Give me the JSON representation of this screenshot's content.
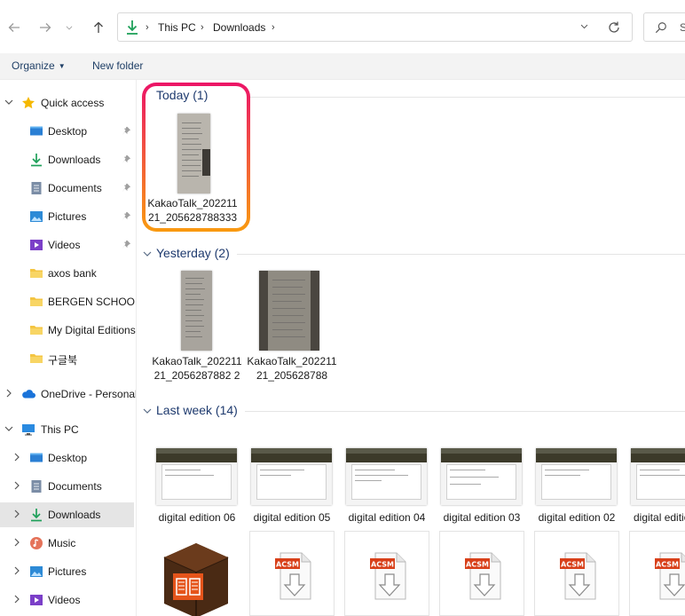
{
  "nav": {
    "back_icon": "arrow-left-icon",
    "forward_icon": "arrow-right-icon",
    "recent_icon": "chevron-down-icon",
    "up_icon": "arrow-up-icon"
  },
  "address": {
    "crumbs": [
      "This PC",
      "Downloads"
    ],
    "location_icon": "download-arrow-icon"
  },
  "search": {
    "placeholder": "S"
  },
  "command_bar": {
    "organize_label": "Organize",
    "new_folder_label": "New folder"
  },
  "sidebar": {
    "quick_access": {
      "label": "Quick access",
      "items": [
        {
          "label": "Desktop",
          "icon": "desktop-icon",
          "pinned": true
        },
        {
          "label": "Downloads",
          "icon": "download-arrow-icon",
          "pinned": true
        },
        {
          "label": "Documents",
          "icon": "documents-icon",
          "pinned": true
        },
        {
          "label": "Pictures",
          "icon": "pictures-icon",
          "pinned": true
        },
        {
          "label": "Videos",
          "icon": "videos-icon",
          "pinned": true
        },
        {
          "label": "axos bank",
          "icon": "folder-icon"
        },
        {
          "label": "BERGEN SCHOOL",
          "icon": "folder-icon"
        },
        {
          "label": "My Digital Editions",
          "icon": "folder-icon"
        },
        {
          "label": "구글북",
          "icon": "folder-icon"
        }
      ]
    },
    "onedrive": {
      "label": "OneDrive - Personal"
    },
    "this_pc": {
      "label": "This PC",
      "items": [
        {
          "label": "Desktop",
          "icon": "desktop-icon"
        },
        {
          "label": "Documents",
          "icon": "documents-icon"
        },
        {
          "label": "Downloads",
          "icon": "download-arrow-icon",
          "selected": true
        },
        {
          "label": "Music",
          "icon": "music-icon"
        },
        {
          "label": "Pictures",
          "icon": "pictures-icon"
        },
        {
          "label": "Videos",
          "icon": "videos-icon"
        }
      ]
    }
  },
  "groups": {
    "today": {
      "label": "Today (1)",
      "files": [
        {
          "name": "KakaoTalk_20221121_2056287883333"
        }
      ]
    },
    "yesterday": {
      "label": "Yesterday (2)",
      "files": [
        {
          "name": "KakaoTalk_20221121_2056287882 2"
        },
        {
          "name": "KakaoTalk_20221121_205628788"
        }
      ]
    },
    "last_week": {
      "label": "Last week (14)",
      "files": [
        {
          "name": "digital edition 06"
        },
        {
          "name": "digital edition 05"
        },
        {
          "name": "digital edition 04"
        },
        {
          "name": "digital edition 03"
        },
        {
          "name": "digital edition 02"
        },
        {
          "name": "digital edition"
        }
      ],
      "second_row_icons": [
        "adobe-digital-editions-box-icon",
        "acsm-file-icon",
        "acsm-file-icon",
        "acsm-file-icon",
        "acsm-file-icon",
        "acsm-file-icon"
      ],
      "acsm_label": "ACSM"
    }
  },
  "colors": {
    "accent_blue": "#1e3a6e",
    "highlight_pink": "#ec1467",
    "highlight_orange": "#f99a10",
    "folder_yellow": "#f4c542"
  }
}
